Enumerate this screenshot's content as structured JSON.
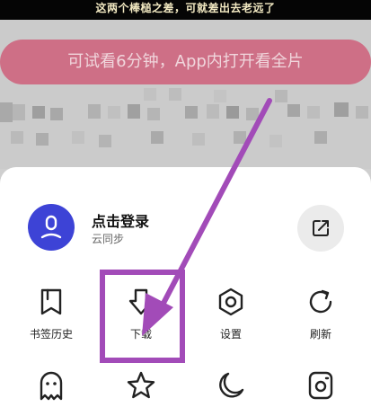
{
  "video": {
    "caption": "这两个棒槌之差，可就差出去老远了"
  },
  "banner": {
    "try_label": "可试看6分钟，App内打开看全片"
  },
  "account": {
    "name": "点击登录",
    "subtitle": "云同步"
  },
  "tools": [
    {
      "label": "书签历史",
      "icon": "bookmark-icon"
    },
    {
      "label": "下载",
      "icon": "download-icon"
    },
    {
      "label": "设置",
      "icon": "settings-icon"
    },
    {
      "label": "刷新",
      "icon": "refresh-icon"
    }
  ],
  "tools_row2": [
    {
      "icon": "ghost-icon"
    },
    {
      "icon": "star-icon"
    },
    {
      "icon": "moon-icon"
    },
    {
      "icon": "screenshot-icon"
    }
  ],
  "colors": {
    "banner": "#ce6f86",
    "avatar": "#3d43d6",
    "annotation": "#a24bb8"
  }
}
